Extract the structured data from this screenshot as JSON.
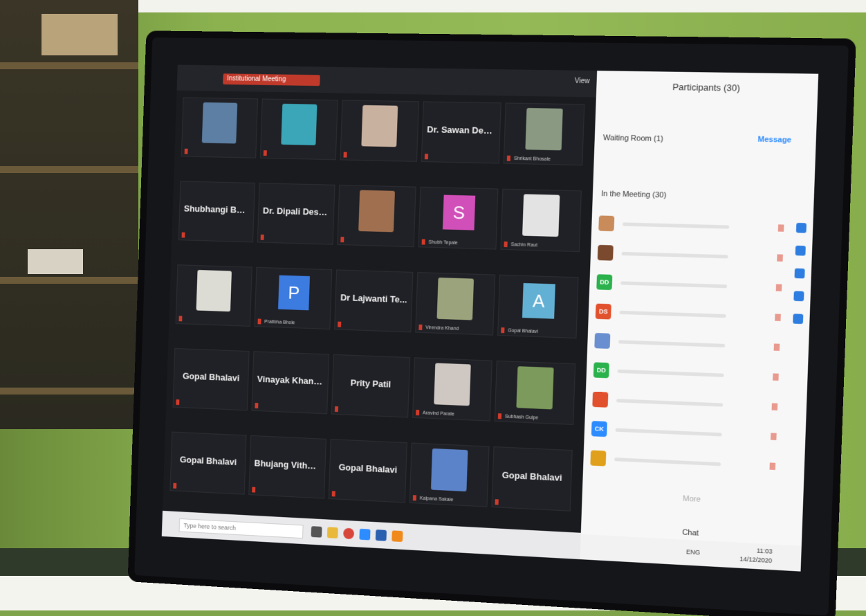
{
  "meeting": {
    "title_tab": "Institutional Meeting",
    "view_label": "View"
  },
  "gallery": {
    "tiles": [
      {
        "name": "",
        "type": "photo",
        "color": "#5c7fa3"
      },
      {
        "name": "",
        "type": "photo",
        "color": "#3aa6b8"
      },
      {
        "name": "",
        "type": "photo",
        "color": "#c9b1a0"
      },
      {
        "name": "Dr. Sawan Desh...",
        "type": "text"
      },
      {
        "name": "",
        "type": "photo",
        "color": "#8a9a82",
        "label": "Shrikant Bhosale"
      },
      {
        "name": "Shubhangi Bha...",
        "type": "text"
      },
      {
        "name": "Dr. Dipali Desh...",
        "type": "text"
      },
      {
        "name": "",
        "type": "photo",
        "color": "#a06f4f"
      },
      {
        "name": "S",
        "type": "avatar",
        "color": "#d14fb8",
        "label": "Shubh Tepale"
      },
      {
        "name": "",
        "type": "photo",
        "color": "#e3e3e3",
        "label": "Sachin Raut"
      },
      {
        "name": "",
        "type": "photo",
        "color": "#dcdcd4"
      },
      {
        "name": "P",
        "type": "avatar",
        "color": "#3c7be0",
        "label": "Pratibha Bhole"
      },
      {
        "name": "Dr Lajwanti Te...",
        "type": "text"
      },
      {
        "name": "",
        "type": "photo",
        "color": "#9aa37c",
        "label": "Virendra Khand"
      },
      {
        "name": "A",
        "type": "avatar",
        "color": "#62b0d4",
        "label": "Gopal Bhalavi"
      },
      {
        "name": "Gopal Bhalavi",
        "type": "text"
      },
      {
        "name": "Vinayak Khand...",
        "type": "text"
      },
      {
        "name": "Prity Patil",
        "type": "text"
      },
      {
        "name": "",
        "type": "photo",
        "color": "#cfc7c2",
        "label": "Aravind Parate"
      },
      {
        "name": "",
        "type": "photo",
        "color": "#7b9a5c",
        "label": "Subhash Gulpe"
      },
      {
        "name": "Gopal Bhalavi",
        "type": "text"
      },
      {
        "name": "Bhujang Vithalr...",
        "type": "text"
      },
      {
        "name": "Gopal Bhalavi",
        "type": "text"
      },
      {
        "name": "",
        "type": "photo",
        "color": "#5b83c9",
        "label": "Kalpana Sakale"
      },
      {
        "name": "Gopal Bhalavi",
        "type": "text"
      }
    ]
  },
  "participants_panel": {
    "title": "Participants (30)",
    "waiting_room": "Waiting Room (1)",
    "message_button": "Message",
    "in_meeting": "In the Meeting (30)",
    "more": "More",
    "chat": "Chat",
    "rows": [
      {
        "initials": "",
        "color": "#c98b5a"
      },
      {
        "initials": "",
        "color": "#7b4a2e"
      },
      {
        "initials": "DD",
        "color": "#2bb24c"
      },
      {
        "initials": "DS",
        "color": "#e2512d"
      },
      {
        "initials": "",
        "color": "#6a8fd0"
      },
      {
        "initials": "DD",
        "color": "#2bb24c"
      },
      {
        "initials": "",
        "color": "#e2512d"
      },
      {
        "initials": "CK",
        "color": "#2d8cff"
      },
      {
        "initials": "",
        "color": "#e0a01c"
      }
    ]
  },
  "taskbar": {
    "search_placeholder": "Type here to search",
    "lang": "ENG",
    "time": "11:03",
    "date": "14/12/2020"
  }
}
